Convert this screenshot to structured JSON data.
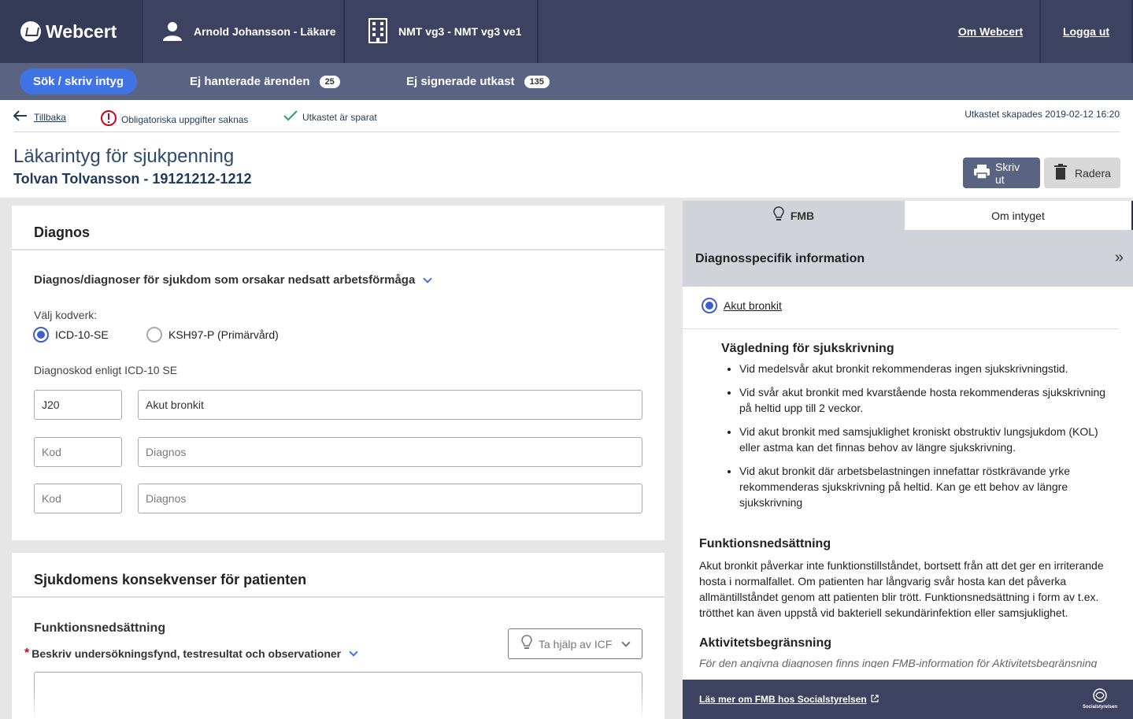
{
  "header": {
    "brand": "Webcert",
    "user": "Arnold Johansson - Läkare",
    "unit": "NMT vg3 - NMT vg3 ve1",
    "about_link": "Om Webcert",
    "logout_link": "Logga ut"
  },
  "nav": {
    "active": "Sök / skriv intyg",
    "items": [
      {
        "label": "Ej hanterade ärenden",
        "count": "25"
      },
      {
        "label": "Ej signerade utkast",
        "count": "135"
      }
    ]
  },
  "status": {
    "back": "Tillbaka",
    "missing": "Obligatoriska uppgifter saknas",
    "saved": "Utkastet är sparat",
    "created": "Utkastet skapades 2019-02-12 16:20"
  },
  "certificate": {
    "title": "Läkarintyg för sjukpenning",
    "patient": "Tolvan Tolvansson - 19121212-1212",
    "print_button": "Skriv ut",
    "delete_button": "Radera"
  },
  "diagnos": {
    "heading": "Diagnos",
    "question": "Diagnos/diagnoser för sjukdom som orsakar nedsatt arbetsförmåga",
    "codesystem_label": "Välj kodverk:",
    "codesystems": [
      "ICD-10-SE",
      "KSH97-P (Primärvård)"
    ],
    "selected_codesystem": "ICD-10-SE",
    "code_label": "Diagnoskod enligt ICD-10 SE",
    "rows": [
      {
        "code": "J20",
        "description": "Akut bronkit"
      },
      {
        "code": "",
        "description": ""
      },
      {
        "code": "",
        "description": ""
      }
    ],
    "code_placeholder": "Kod",
    "description_placeholder": "Diagnos"
  },
  "konsekvenser": {
    "heading": "Sjukdomens konsekvenser för patienten",
    "subheading": "Funktionsnedsättning",
    "required_mark": "*",
    "question": "Beskriv undersökningsfynd, testresultat och observationer",
    "icf_button": "Ta hjälp av ICF"
  },
  "sidepanel": {
    "tabs": [
      "FMB",
      "Om intyget"
    ],
    "active_tab": "FMB",
    "heading": "Diagnosspecifik information",
    "collapse_symbol": "»",
    "selected_diagnosis": "Akut bronkit",
    "guidance_heading": "Vägledning för sjukskrivning",
    "guidance": [
      "Vid medelsvår akut bronkit rekommenderas ingen sjukskrivningstid.",
      "Vid svår akut bronkit med kvarstående hosta rekommenderas sjukskrivning på heltid upp till 2 veckor.",
      "Vid akut bronkit med samsjuklighet kroniskt obstruktiv lungsjukdom (KOL) eller astma kan det finnas behov av längre sjukskrivning.",
      "Vid akut bronkit där arbetsbelastningen innefattar röstkrävande yrke rekommenderas sjukskrivning på heltid. Kan ge ett behov av längre sjukskrivning"
    ],
    "function_heading": "Funktionsnedsättning",
    "function_text": "Akut bronkit påverkar inte funktionstillståndet, bortsett från att det ger en irriterande hosta i normalfallet. Om patienten har långvarig svår hosta kan det påverka allmäntillståndet genom att patienten blir trött. Funktionsnedsättning i form av t.ex. trötthet kan även uppstå vid bakteriell sekundärinfektion eller samsjuklighet.",
    "activity_heading": "Aktivitetsbegränsning",
    "activity_text": "För den angivna diagnosen finns ingen FMB-information för Aktivitetsbegränsning",
    "footer_link": "Läs mer om FMB hos Socialstyrelsen",
    "footer_logo_text": "Socialstyrelsen"
  }
}
